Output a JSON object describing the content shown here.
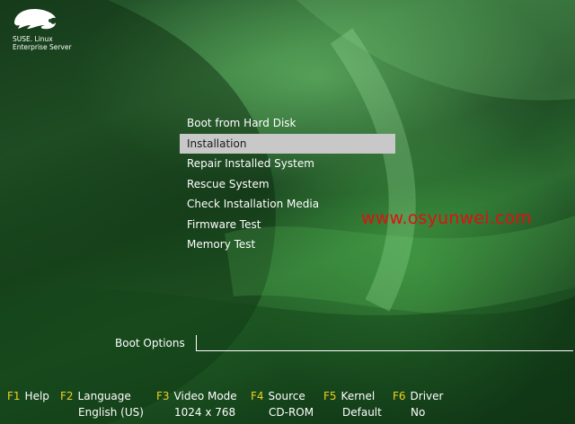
{
  "brand": {
    "logo_icon": "chameleon-icon",
    "line1": "SUSE. Linux",
    "line2": "Enterprise Server"
  },
  "menu": {
    "selected_index": 1,
    "items": [
      {
        "label": "Boot from Hard Disk"
      },
      {
        "label": "Installation"
      },
      {
        "label": "Repair Installed System"
      },
      {
        "label": "Rescue System"
      },
      {
        "label": "Check Installation Media"
      },
      {
        "label": "Firmware Test"
      },
      {
        "label": "Memory Test"
      }
    ]
  },
  "watermark": {
    "text": "www.osyunwei.com",
    "color": "#e01010"
  },
  "boot_options": {
    "label": "Boot Options",
    "value": ""
  },
  "function_keys": [
    {
      "key": "F1",
      "label": "Help",
      "value": ""
    },
    {
      "key": "F2",
      "label": "Language",
      "value": "English (US)"
    },
    {
      "key": "F3",
      "label": "Video Mode",
      "value": "1024 x 768"
    },
    {
      "key": "F4",
      "label": "Source",
      "value": "CD-ROM"
    },
    {
      "key": "F5",
      "label": "Kernel",
      "value": "Default"
    },
    {
      "key": "F6",
      "label": "Driver",
      "value": "No"
    }
  ],
  "colors": {
    "fkey": "#f0d020",
    "selection": "#c8c8c8",
    "background": "#2f6b35"
  }
}
